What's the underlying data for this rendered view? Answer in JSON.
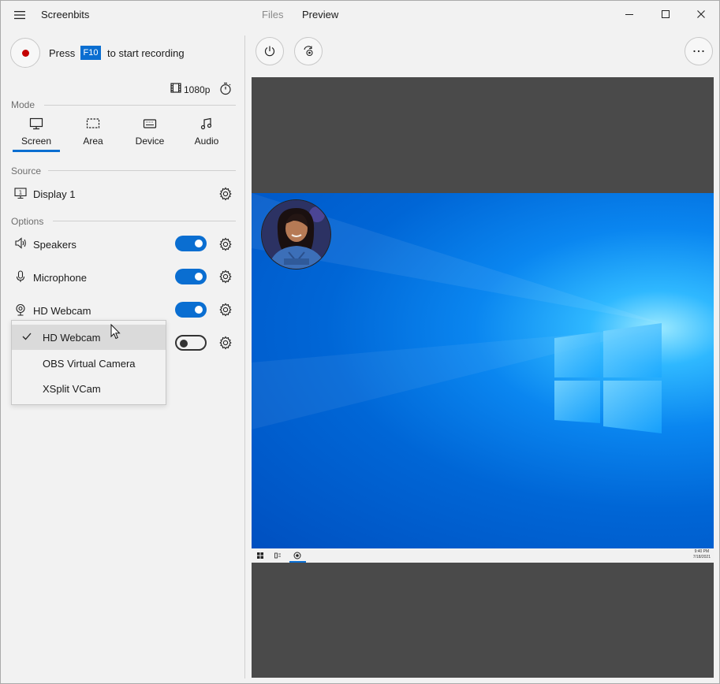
{
  "app": {
    "title": "Screenbits"
  },
  "tabs": [
    {
      "label": "Files",
      "active": false
    },
    {
      "label": "Preview",
      "active": true
    }
  ],
  "record": {
    "press": "Press",
    "key": "F10",
    "suffix": "to start recording"
  },
  "resolution": "1080p",
  "mode": {
    "label": "Mode",
    "items": [
      {
        "label": "Screen",
        "icon": "monitor-icon",
        "active": true
      },
      {
        "label": "Area",
        "icon": "area-select-icon",
        "active": false
      },
      {
        "label": "Device",
        "icon": "device-icon",
        "active": false
      },
      {
        "label": "Audio",
        "icon": "music-note-icon",
        "active": false
      }
    ]
  },
  "source": {
    "label": "Source",
    "value": "Display 1"
  },
  "options": {
    "label": "Options",
    "items": [
      {
        "label": "Speakers",
        "icon": "speaker-icon",
        "enabled": true
      },
      {
        "label": "Microphone",
        "icon": "microphone-icon",
        "enabled": true
      },
      {
        "label": "HD Webcam",
        "icon": "webcam-icon",
        "enabled": true
      },
      {
        "label": "",
        "icon": "",
        "enabled": false
      }
    ]
  },
  "webcam_dropdown": {
    "selected": "HD Webcam",
    "items": [
      "HD Webcam",
      "OBS Virtual Camera",
      "XSplit VCam"
    ]
  },
  "preview": {
    "taskbar_time": "9:40 PM",
    "taskbar_date": "7/18/2021"
  },
  "colors": {
    "accent": "#0a6ed1",
    "record": "#c40000",
    "preview_bg": "#4a4a4a"
  }
}
